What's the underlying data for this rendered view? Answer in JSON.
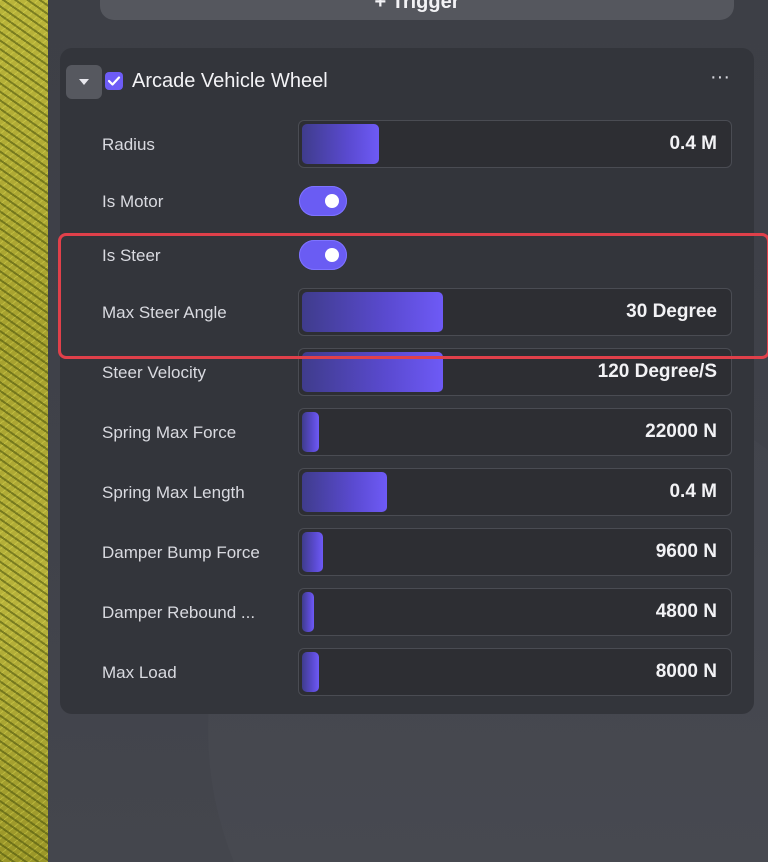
{
  "top_button": {
    "label": "+ Trigger"
  },
  "component": {
    "title": "Arcade Vehicle Wheel",
    "enabled": true,
    "more_label": "···"
  },
  "properties": [
    {
      "label": "Radius",
      "type": "slider",
      "value": "0.4 M",
      "fill": 0.18
    },
    {
      "label": "Is Motor",
      "type": "toggle",
      "on": true
    },
    {
      "label": "Is Steer",
      "type": "toggle",
      "on": true
    },
    {
      "label": "Max Steer Angle",
      "type": "slider",
      "value": "30 Degree",
      "fill": 0.33
    },
    {
      "label": "Steer Velocity",
      "type": "slider",
      "value": "120 Degree/S",
      "fill": 0.33
    },
    {
      "label": "Spring Max Force",
      "type": "slider",
      "value": "22000 N",
      "fill": 0.04
    },
    {
      "label": "Spring Max Length",
      "type": "slider",
      "value": "0.4 M",
      "fill": 0.2
    },
    {
      "label": "Damper Bump Force",
      "type": "slider",
      "value": "9600 N",
      "fill": 0.05
    },
    {
      "label": "Damper Rebound ...",
      "type": "slider",
      "value": "4800 N",
      "fill": 0.02
    },
    {
      "label": "Max Load",
      "type": "slider",
      "value": "8000 N",
      "fill": 0.04
    }
  ],
  "colors": {
    "accent": "#6e5af6",
    "highlight": "#e0404a"
  }
}
